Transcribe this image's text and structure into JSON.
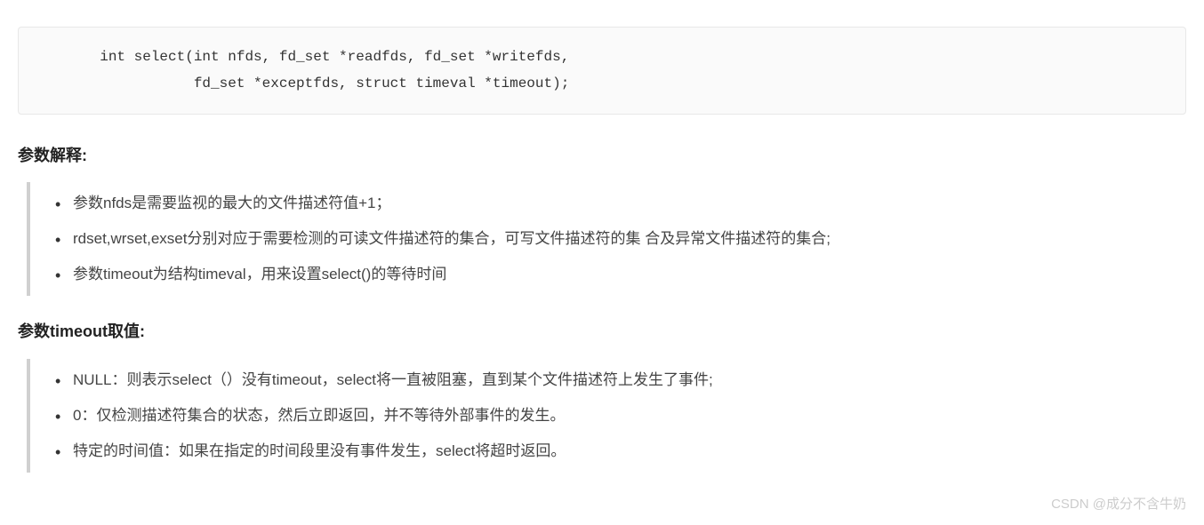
{
  "code": {
    "line1": "       int select(int nfds, fd_set *readfds, fd_set *writefds,",
    "line2": "                  fd_set *exceptfds, struct timeval *timeout);"
  },
  "section1": {
    "heading": "参数解释:",
    "items": [
      "参数nfds是需要监视的最大的文件描述符值+1；",
      "rdset,wrset,exset分别对应于需要检测的可读文件描述符的集合，可写文件描述符的集 合及异常文件描述符的集合;",
      "参数timeout为结构timeval，用来设置select()的等待时间"
    ]
  },
  "section2": {
    "heading": "参数timeout取值:",
    "items": [
      "NULL：则表示select（）没有timeout，select将一直被阻塞，直到某个文件描述符上发生了事件;",
      "0：仅检测描述符集合的状态，然后立即返回，并不等待外部事件的发生。",
      "特定的时间值：如果在指定的时间段里没有事件发生，select将超时返回。"
    ]
  },
  "watermark": "CSDN @成分不含牛奶"
}
